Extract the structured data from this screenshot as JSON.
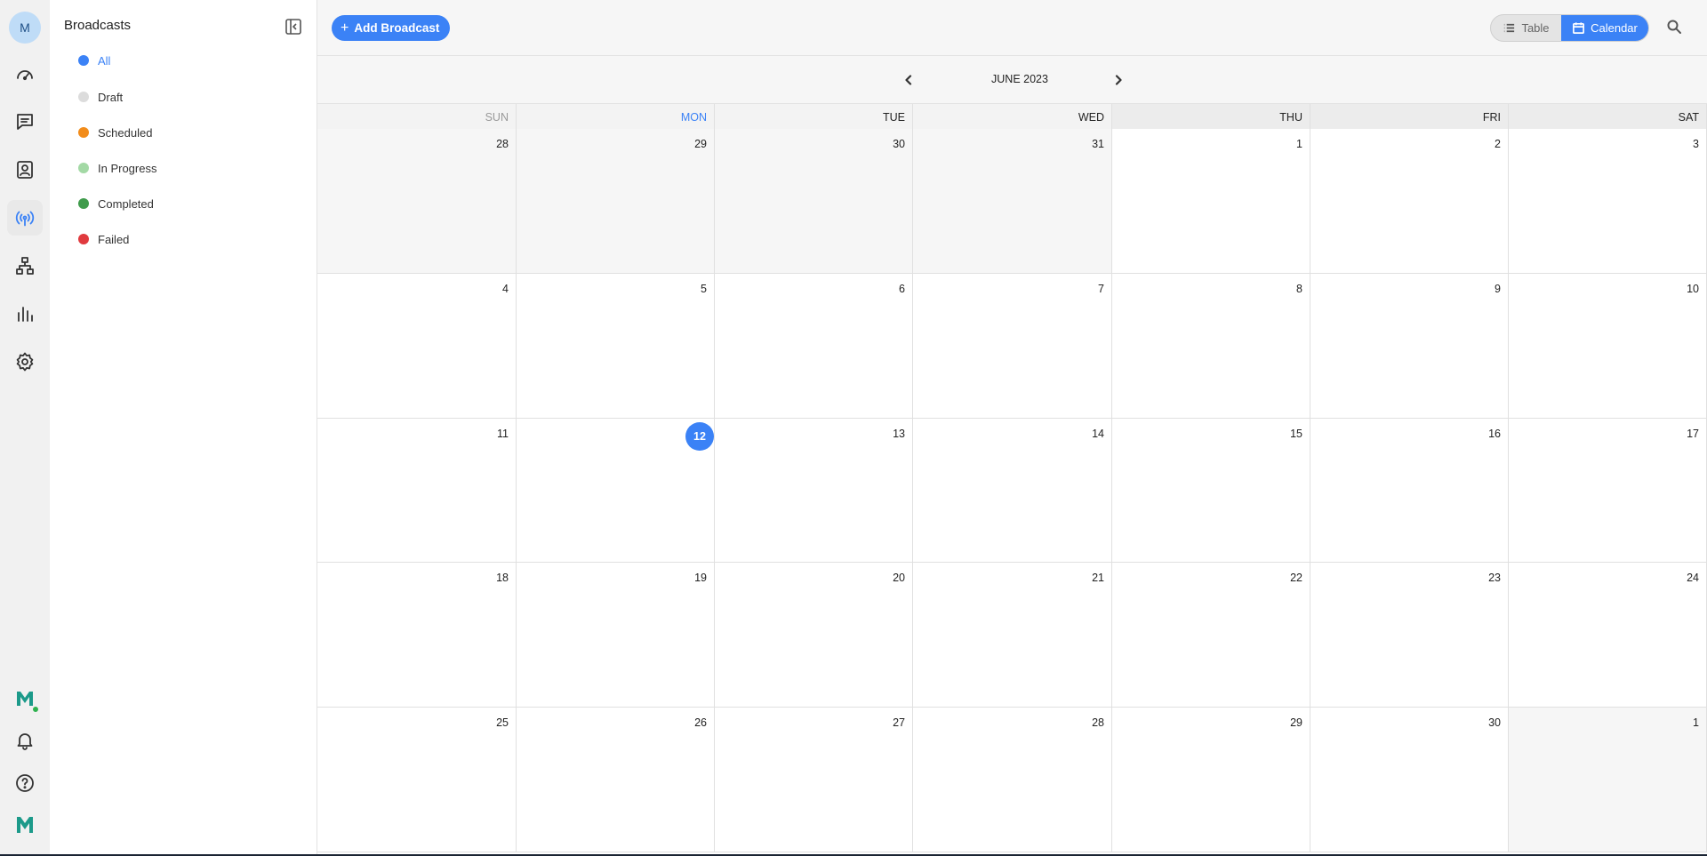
{
  "rail": {
    "avatar_initial": "M",
    "items": [
      {
        "icon": "speedometer-icon"
      },
      {
        "icon": "chat-icon"
      },
      {
        "icon": "contact-icon"
      },
      {
        "icon": "broadcast-icon",
        "active": true
      },
      {
        "icon": "flow-icon"
      },
      {
        "icon": "analytics-icon"
      },
      {
        "icon": "settings-icon"
      }
    ],
    "bottom": [
      {
        "icon": "brand-logo-icon"
      },
      {
        "icon": "bell-icon"
      },
      {
        "icon": "help-icon"
      },
      {
        "icon": "brand-logo-icon"
      }
    ]
  },
  "panel": {
    "title": "Broadcasts",
    "statuses": [
      {
        "label": "All",
        "color": "#3b82f6",
        "selected": true
      },
      {
        "label": "Draft",
        "color": "#dcdcdc"
      },
      {
        "label": "Scheduled",
        "color": "#f28c1a"
      },
      {
        "label": "In Progress",
        "color": "#a3d9a5"
      },
      {
        "label": "Completed",
        "color": "#3f9b4b"
      },
      {
        "label": "Failed",
        "color": "#e03a3e"
      }
    ]
  },
  "toolbar": {
    "add_label": "Add Broadcast",
    "view_table": "Table",
    "view_calendar": "Calendar",
    "active_view": "Calendar"
  },
  "calendar": {
    "month_label": "JUNE 2023",
    "weekdays": [
      "SUN",
      "MON",
      "TUE",
      "WED",
      "THU",
      "FRI",
      "SAT"
    ],
    "today": 12,
    "weeks": [
      [
        {
          "d": "28",
          "s": "past"
        },
        {
          "d": "29",
          "s": "past"
        },
        {
          "d": "30",
          "s": "past"
        },
        {
          "d": "31",
          "s": "past"
        },
        {
          "d": "1"
        },
        {
          "d": "2"
        },
        {
          "d": "3"
        }
      ],
      [
        {
          "d": "4"
        },
        {
          "d": "5"
        },
        {
          "d": "6"
        },
        {
          "d": "7"
        },
        {
          "d": "8"
        },
        {
          "d": "9"
        },
        {
          "d": "10"
        }
      ],
      [
        {
          "d": "11"
        },
        {
          "d": "12",
          "s": "today"
        },
        {
          "d": "13"
        },
        {
          "d": "14"
        },
        {
          "d": "15"
        },
        {
          "d": "16"
        },
        {
          "d": "17"
        }
      ],
      [
        {
          "d": "18"
        },
        {
          "d": "19"
        },
        {
          "d": "20"
        },
        {
          "d": "21"
        },
        {
          "d": "22"
        },
        {
          "d": "23"
        },
        {
          "d": "24"
        }
      ],
      [
        {
          "d": "25"
        },
        {
          "d": "26"
        },
        {
          "d": "27"
        },
        {
          "d": "28"
        },
        {
          "d": "29"
        },
        {
          "d": "30"
        },
        {
          "d": "1",
          "s": "other"
        }
      ]
    ]
  }
}
